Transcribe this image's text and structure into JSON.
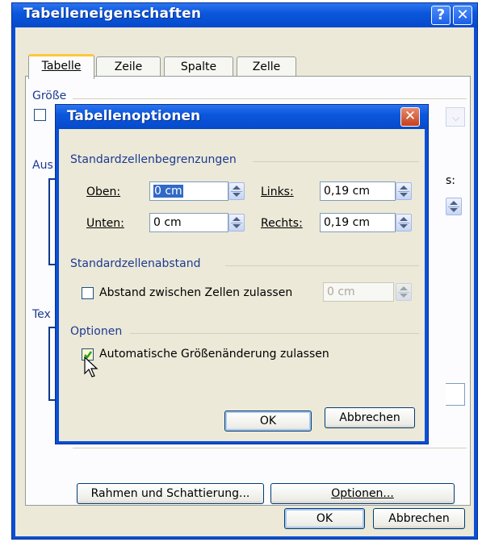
{
  "outer": {
    "title": "Tabelleneigenschaften",
    "help_label": "?",
    "close_label": "✕",
    "tabs": [
      "Tabelle",
      "Zeile",
      "Spalte",
      "Zelle"
    ],
    "groups": {
      "size": "Größe",
      "alignment": "Aus",
      "text_wrap": "Tex"
    },
    "buttons": {
      "borders": "Rahmen und Schattierung...",
      "options": "Optionen...",
      "ok": "OK",
      "cancel": "Abbrechen"
    },
    "partial_label": "s:"
  },
  "inner": {
    "title": "Tabellenoptionen",
    "close_label": "✕",
    "margins_group": "Standardzellenbegrenzungen",
    "top_label": "Oben:",
    "top_value": "0 cm",
    "bottom_label": "Unten:",
    "bottom_value": "0 cm",
    "left_label": "Links:",
    "left_value": "0,19 cm",
    "right_label": "Rechts:",
    "right_value": "0,19 cm",
    "spacing_group": "Standardzellenabstand",
    "spacing_check_label": "Abstand zwischen Zellen zulassen",
    "spacing_check_checked": false,
    "spacing_value": "0 cm",
    "options_group": "Optionen",
    "autoresize_label": "Automatische Größenänderung zulassen",
    "autoresize_checked": true,
    "ok": "OK",
    "cancel": "Abbrechen"
  },
  "colors": {
    "titlebar": "#0b57dc",
    "dialog_bg": "#ece9d8",
    "group_label": "#1d3a91",
    "tab_highlight": "#ffc83c",
    "close_red": "#c3401e"
  }
}
